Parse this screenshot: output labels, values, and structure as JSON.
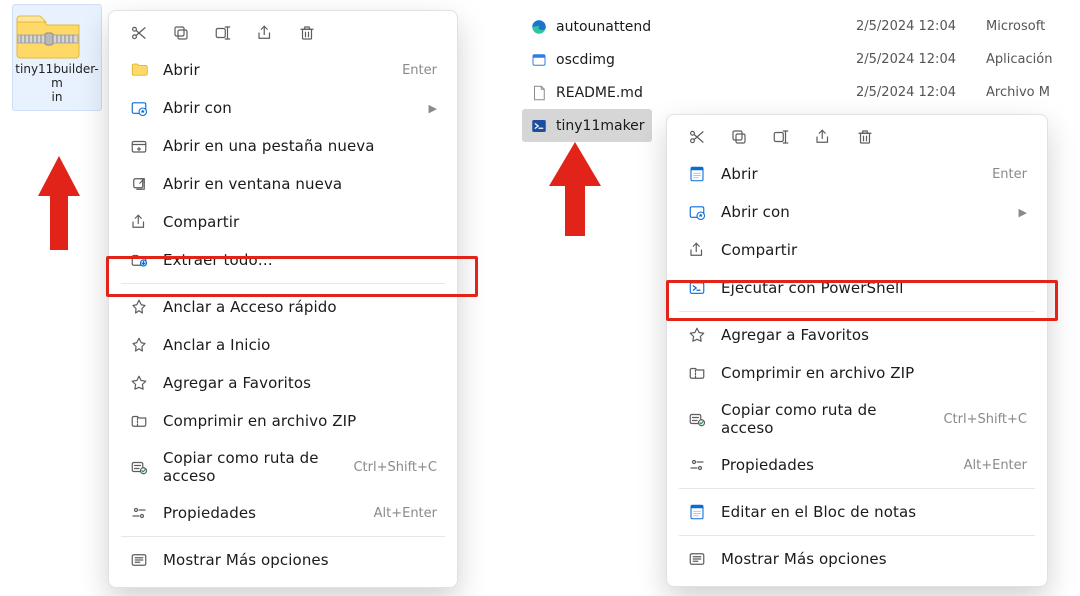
{
  "desktop_icon": {
    "label": "tiny11builder-m\nin"
  },
  "file_list": [
    {
      "icon": "edge",
      "name": "autounattend",
      "date": "2/5/2024 12:04",
      "type": "Microsoft"
    },
    {
      "icon": "exe",
      "name": "oscdimg",
      "date": "2/5/2024 12:04",
      "type": "Aplicación"
    },
    {
      "icon": "file",
      "name": "README.md",
      "date": "2/5/2024 12:04",
      "type": "Archivo M"
    },
    {
      "icon": "ps1",
      "name": "tiny11maker",
      "date": "",
      "type": "",
      "selected": true
    }
  ],
  "menu_left": {
    "items": [
      {
        "icon": "folder",
        "label": "Abrir",
        "shortcut": "Enter"
      },
      {
        "icon": "openwith",
        "label": "Abrir con",
        "chev": true
      },
      {
        "icon": "newtab",
        "label": "Abrir en una pestaña nueva"
      },
      {
        "icon": "newwin",
        "label": "Abrir en ventana nueva"
      },
      {
        "icon": "share",
        "label": "Compartir"
      },
      {
        "icon": "extract",
        "label": "Extraer todo…"
      },
      {
        "sep": true
      },
      {
        "icon": "pin",
        "label": "Anclar a Acceso rápido"
      },
      {
        "icon": "pin",
        "label": "Anclar a Inicio"
      },
      {
        "icon": "star",
        "label": "Agregar a Favoritos"
      },
      {
        "icon": "zip",
        "label": "Comprimir en archivo ZIP"
      },
      {
        "icon": "copypath",
        "label": "Copiar como ruta de acceso",
        "shortcut": "Ctrl+Shift+C"
      },
      {
        "icon": "props",
        "label": "Propiedades",
        "shortcut": "Alt+Enter"
      },
      {
        "sep": true
      },
      {
        "icon": "more",
        "label": "Mostrar Más opciones"
      }
    ]
  },
  "menu_right": {
    "items": [
      {
        "icon": "notepad",
        "label": "Abrir",
        "shortcut": "Enter"
      },
      {
        "icon": "openwith",
        "label": "Abrir con",
        "chev": true
      },
      {
        "icon": "share",
        "label": "Compartir"
      },
      {
        "icon": "powershell",
        "label": "Ejecutar con PowerShell"
      },
      {
        "sep": true
      },
      {
        "icon": "star",
        "label": "Agregar a Favoritos"
      },
      {
        "icon": "zip",
        "label": "Comprimir en archivo ZIP"
      },
      {
        "icon": "copypath",
        "label": "Copiar como ruta de acceso",
        "shortcut": "Ctrl+Shift+C"
      },
      {
        "icon": "props",
        "label": "Propiedades",
        "shortcut": "Alt+Enter"
      },
      {
        "sep": true
      },
      {
        "icon": "notepad",
        "label": "Editar en el Bloc de notas"
      },
      {
        "sep": true
      },
      {
        "icon": "more",
        "label": "Mostrar Más opciones"
      }
    ]
  }
}
